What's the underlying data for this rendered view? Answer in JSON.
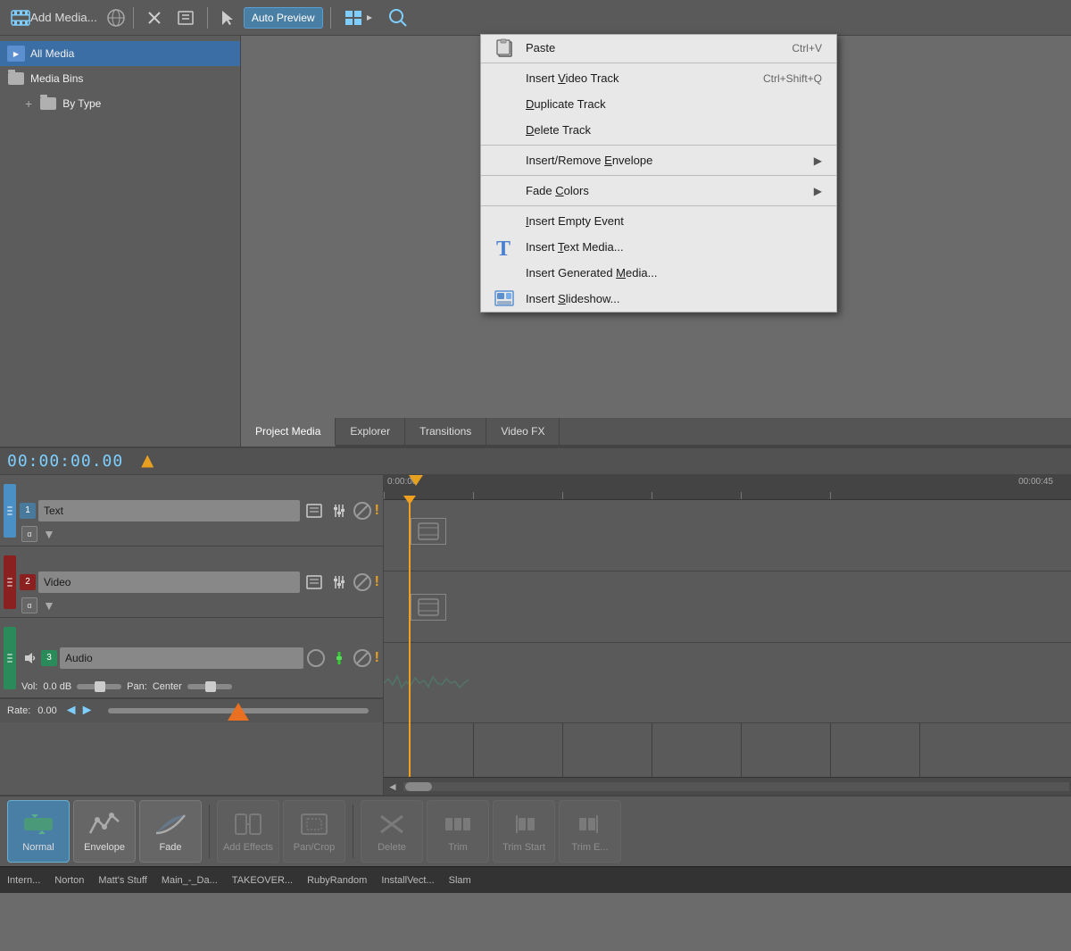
{
  "toolbar": {
    "add_media_label": "Add Media...",
    "auto_preview_label": "Auto Preview",
    "cursor_label": "▶"
  },
  "media_panel": {
    "items": [
      {
        "id": "all_media",
        "label": "All Media",
        "type": "media",
        "selected": true
      },
      {
        "id": "media_bins",
        "label": "Media Bins",
        "type": "folder",
        "child": false
      },
      {
        "id": "by_type",
        "label": "By Type",
        "type": "folder",
        "child": true
      }
    ]
  },
  "tabs": [
    {
      "id": "project_media",
      "label": "Project Media",
      "active": true
    },
    {
      "id": "explorer",
      "label": "Explorer",
      "active": false
    },
    {
      "id": "transitions",
      "label": "Transitions",
      "active": false
    },
    {
      "id": "video_fx",
      "label": "Video FX",
      "active": false
    }
  ],
  "timeline": {
    "timecode": "00:00:00.00",
    "ruler_marks": [
      "0:00:00",
      "00:00:45"
    ],
    "tracks": [
      {
        "num": 1,
        "name": "Text",
        "type": "text"
      },
      {
        "num": 2,
        "name": "Video",
        "type": "video"
      },
      {
        "num": 3,
        "name": "Audio",
        "type": "audio"
      }
    ],
    "audio_vol_label": "Vol:",
    "audio_vol_value": "0.0 dB",
    "audio_pan_label": "Pan:",
    "audio_pan_value": "Center"
  },
  "rate": {
    "label": "Rate:",
    "value": "0.00"
  },
  "bottom_toolbar": {
    "tools": [
      {
        "id": "normal",
        "label": "Normal",
        "active": true
      },
      {
        "id": "envelope",
        "label": "Envelope",
        "active": false
      },
      {
        "id": "fade",
        "label": "Fade",
        "active": false
      },
      {
        "id": "add_effects",
        "label": "Add Effects",
        "active": false,
        "disabled": true
      },
      {
        "id": "pan_crop",
        "label": "Pan/Crop",
        "active": false,
        "disabled": true
      },
      {
        "id": "delete",
        "label": "Delete",
        "active": false,
        "disabled": true
      },
      {
        "id": "trim",
        "label": "Trim",
        "active": false,
        "disabled": true
      },
      {
        "id": "trim_start",
        "label": "Trim Start",
        "active": false,
        "disabled": true
      },
      {
        "id": "trim_end",
        "label": "Trim E...",
        "active": false,
        "disabled": true
      }
    ]
  },
  "context_menu": {
    "items": [
      {
        "id": "paste",
        "label": "Paste",
        "shortcut": "Ctrl+V",
        "has_icon": true,
        "type": "item"
      },
      {
        "type": "separator"
      },
      {
        "id": "insert_video_track",
        "label": "Insert Video Track",
        "shortcut": "Ctrl+Shift+Q",
        "underline": "V",
        "type": "item"
      },
      {
        "id": "duplicate_track",
        "label": "Duplicate Track",
        "underline": "D",
        "type": "item"
      },
      {
        "id": "delete_track",
        "label": "Delete Track",
        "underline": "D",
        "type": "item"
      },
      {
        "type": "separator"
      },
      {
        "id": "insert_remove_envelope",
        "label": "Insert/Remove Envelope",
        "underline": "E",
        "has_arrow": true,
        "type": "item"
      },
      {
        "type": "separator"
      },
      {
        "id": "fade_colors",
        "label": "Fade Colors",
        "underline": "C",
        "has_arrow": true,
        "type": "item"
      },
      {
        "type": "separator"
      },
      {
        "id": "insert_empty_event",
        "label": "Insert Empty Event",
        "underline": "I",
        "type": "item"
      },
      {
        "id": "insert_text_media",
        "label": "Insert Text Media...",
        "underline": "T",
        "has_icon": true,
        "type": "item"
      },
      {
        "id": "insert_generated_media",
        "label": "Insert Generated Media...",
        "underline": "M",
        "type": "item"
      },
      {
        "id": "insert_slideshow",
        "label": "Insert Slideshow...",
        "underline": "S",
        "has_icon": true,
        "type": "item"
      }
    ]
  },
  "status_bar": {
    "items": [
      "Norton",
      "Matt's Stuff",
      "Main_-_Da...",
      "TAKEOVER...",
      "RubyRandom",
      "InstallVect...",
      "Slam"
    ],
    "intern_label": "Intern..."
  }
}
